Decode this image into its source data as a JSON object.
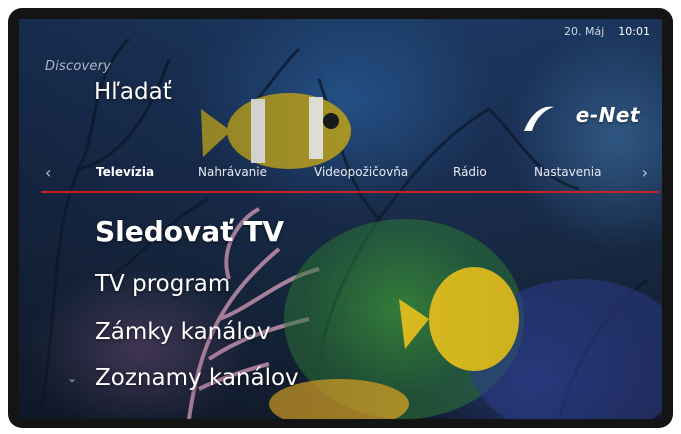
{
  "status_bar": {
    "date": "20. Máj",
    "time": "10:01"
  },
  "channel_logo": "Discovery",
  "header": {
    "title": "Hľadať",
    "brand": "e-Net"
  },
  "nav": {
    "left_arrow": "‹",
    "right_arrow": "›",
    "tabs": [
      {
        "label": "Televízia",
        "active": true
      },
      {
        "label": "Nahrávanie",
        "active": false
      },
      {
        "label": "Videopožičovňa",
        "active": false
      },
      {
        "label": "Rádio",
        "active": false
      },
      {
        "label": "Nastavenia",
        "active": false
      }
    ]
  },
  "menu": {
    "items": [
      {
        "label": "Sledovať TV",
        "selected": true
      },
      {
        "label": "TV program",
        "selected": false
      },
      {
        "label": "Zámky kanálov",
        "selected": false
      },
      {
        "label": "Zoznamy kanálov",
        "selected": false
      }
    ],
    "scroll_indicator": "⌄"
  },
  "colors": {
    "accent_line": "#c81f22",
    "text": "#ffffff"
  },
  "icons": {
    "left_arrow": "chevron-left-icon",
    "right_arrow": "chevron-right-icon",
    "scroll": "chevron-down-icon",
    "brand": "e-net-logo-icon"
  }
}
